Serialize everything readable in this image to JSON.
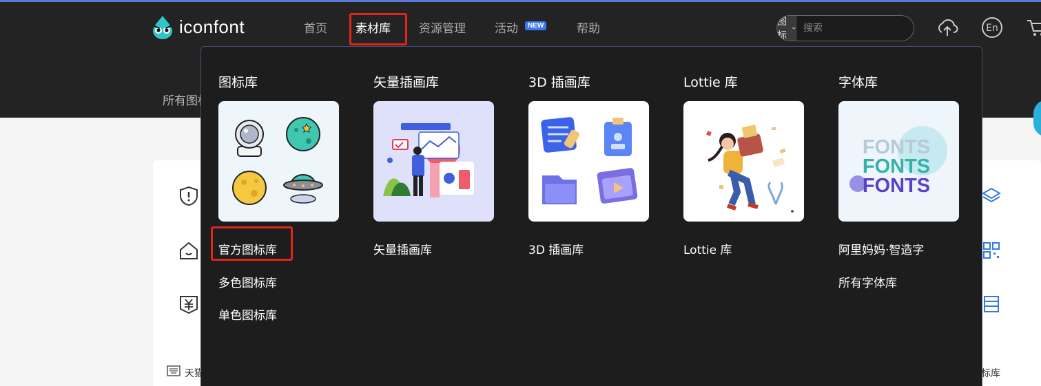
{
  "brand": {
    "name": "iconfont"
  },
  "nav": {
    "items": [
      {
        "label": "首页"
      },
      {
        "label": "素材库"
      },
      {
        "label": "资源管理"
      },
      {
        "label": "活动"
      },
      {
        "label": "帮助"
      }
    ],
    "new_badge": "NEW"
  },
  "search": {
    "type_label": "图标",
    "placeholder": "搜索"
  },
  "header_icons": [
    "upload-cloud-icon",
    "language-en-icon",
    "cart-icon"
  ],
  "language_label": "En",
  "subnav": {
    "partial_label": "所有图标"
  },
  "dropdown": {
    "columns": [
      {
        "title": "图标库",
        "links": [
          "官方图标库",
          "多色图标库",
          "单色图标库"
        ]
      },
      {
        "title": "矢量插画库",
        "links": [
          "矢量插画库"
        ]
      },
      {
        "title": "3D 插画库",
        "links": [
          "3D 插画库"
        ]
      },
      {
        "title": "Lottie 库",
        "links": [
          "Lottie 库"
        ]
      },
      {
        "title": "字体库",
        "links": [
          "阿里妈妈·智造字",
          "所有字体库"
        ]
      }
    ],
    "font_thumb_text": "FONTS"
  },
  "page": {
    "footer_left": "天猫",
    "footer_right": "标库"
  },
  "colors": {
    "header_bg": "#232323",
    "dropdown_bg": "#1d1d1d",
    "highlight_red": "#e0261a",
    "badge_blue": "#3a78f2",
    "accent_cyan": "#2ab0d8",
    "link_blue": "#2f7be0"
  }
}
